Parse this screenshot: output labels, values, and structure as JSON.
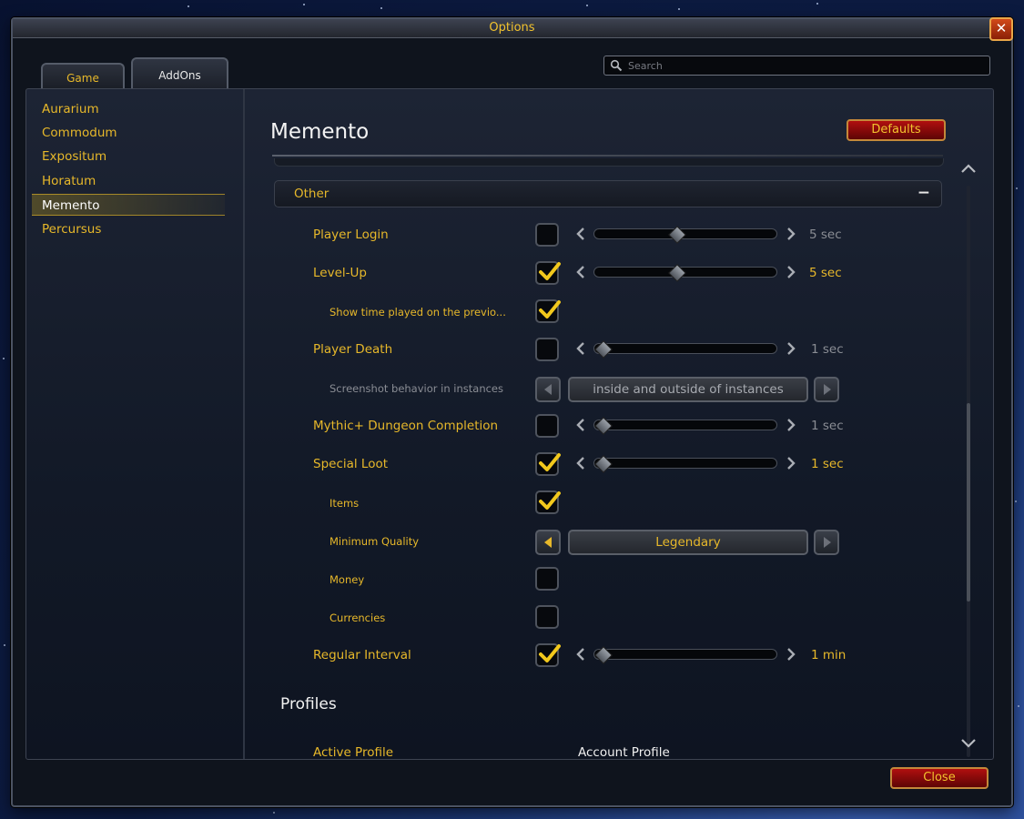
{
  "window": {
    "title": "Options"
  },
  "tabs": [
    {
      "label": "Game"
    },
    {
      "label": "AddOns"
    }
  ],
  "search": {
    "placeholder": "Search"
  },
  "sidebar": {
    "items": [
      {
        "label": "Aurarium"
      },
      {
        "label": "Commodum"
      },
      {
        "label": "Expositum"
      },
      {
        "label": "Horatum"
      },
      {
        "label": "Memento",
        "selected": true
      },
      {
        "label": "Percursus"
      }
    ]
  },
  "panel": {
    "title": "Memento",
    "defaults_label": "Defaults",
    "section": {
      "label": "Other",
      "toggle": "−"
    },
    "rows": {
      "player_login": {
        "label": "Player Login",
        "checked": false,
        "value": "5 sec",
        "slider_fraction": 0.45
      },
      "level_up": {
        "label": "Level-Up",
        "checked": true,
        "value": "5 sec",
        "slider_fraction": 0.45
      },
      "show_time_played": {
        "label": "Show time played on the previo...",
        "checked": true
      },
      "player_death": {
        "label": "Player Death",
        "checked": false,
        "value": "1 sec",
        "slider_fraction": 0.0
      },
      "screenshot_behavior": {
        "label": "Screenshot behavior in instances",
        "value": "inside and outside of instances"
      },
      "mythic_plus": {
        "label": "Mythic+ Dungeon Completion",
        "checked": false,
        "value": "1 sec",
        "slider_fraction": 0.0
      },
      "special_loot": {
        "label": "Special Loot",
        "checked": true,
        "value": "1 sec",
        "slider_fraction": 0.0
      },
      "items": {
        "label": "Items",
        "checked": true
      },
      "minimum_quality": {
        "label": "Minimum Quality",
        "value": "Legendary"
      },
      "money": {
        "label": "Money",
        "checked": false
      },
      "currencies": {
        "label": "Currencies",
        "checked": false
      },
      "regular_interval": {
        "label": "Regular Interval",
        "checked": true,
        "value": "1 min",
        "slider_fraction": 0.0
      }
    },
    "profiles": {
      "heading": "Profiles",
      "active_profile_label": "Active Profile",
      "active_profile_value": "Account Profile"
    }
  },
  "footer": {
    "close_label": "Close"
  },
  "colors": {
    "gold": "#e7b82a",
    "red_button": "#8e0b0b",
    "disabled_text": "#8a8d94"
  }
}
